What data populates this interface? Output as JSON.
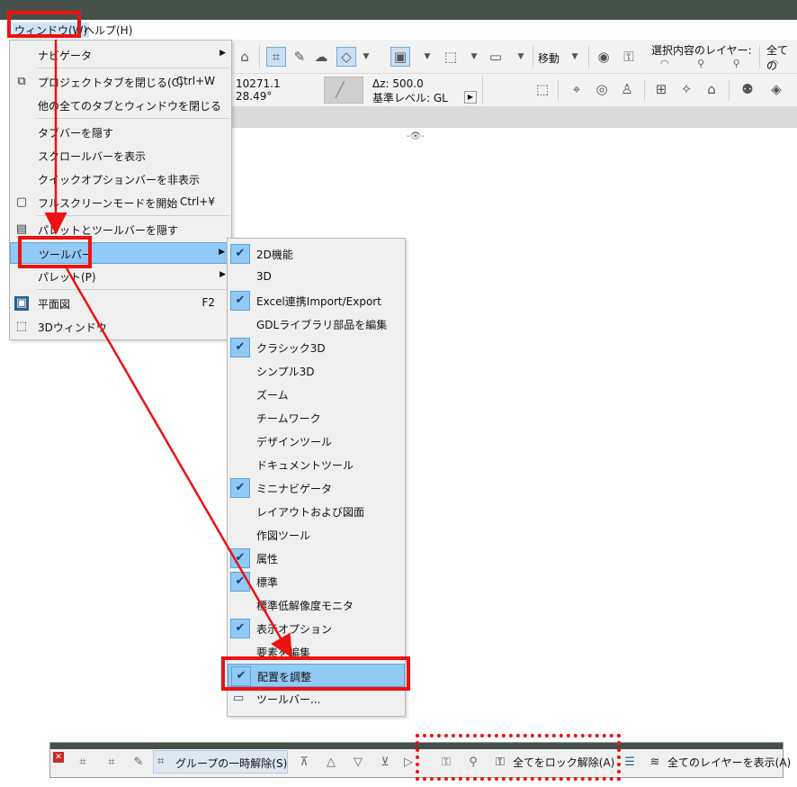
{
  "menubar": {
    "window": "ウィンドウ(W)",
    "help": "ヘルプ(H)"
  },
  "toolbar": {
    "move_label": "移動",
    "layer_label": "選択内容のレイヤー:",
    "all_label": "全ての",
    "x_value": "10271.1",
    "angle_value": "28.49°",
    "dz_label": "Δz: 500.0",
    "level_label": "基準レベル: GL",
    "eye_indicator": "-👁-"
  },
  "window_menu": {
    "items": [
      {
        "label": "ナビゲータ",
        "submenu": true
      },
      {
        "label": "プロジェクトタブを閉じる(C)",
        "shortcut": "Ctrl+W",
        "icon": "close-tab-icon"
      },
      {
        "label": "他の全てのタブとウィンドウを閉じる"
      },
      {
        "label": "タブバーを隠す"
      },
      {
        "label": "スクロールバーを表示"
      },
      {
        "label": "クイックオプションバーを非表示"
      },
      {
        "label": "フルスクリーンモードを開始",
        "shortcut": "Ctrl+¥",
        "icon": "fullscreen-icon"
      },
      {
        "label": "パレットとツールバーを隠す",
        "icon": "palette-icon"
      },
      {
        "label": "ツールバー",
        "submenu": true
      },
      {
        "label": "パレット(P)",
        "submenu": true
      },
      {
        "label": "平面図",
        "shortcut": "F2",
        "icon": "floorplan-icon"
      },
      {
        "label": "3Dウィンドウ",
        "icon": "3d-window-icon"
      }
    ]
  },
  "toolbar_submenu": {
    "items": [
      {
        "label": "2D機能",
        "checked": true
      },
      {
        "label": "3D",
        "checked": false
      },
      {
        "label": "Excel連携Import/Export",
        "checked": true
      },
      {
        "label": "GDLライブラリ部品を編集",
        "checked": false
      },
      {
        "label": "クラシック3D",
        "checked": true
      },
      {
        "label": "シンプル3D",
        "checked": false
      },
      {
        "label": "ズーム",
        "checked": false
      },
      {
        "label": "チームワーク",
        "checked": false
      },
      {
        "label": "デザインツール",
        "checked": false
      },
      {
        "label": "ドキュメントツール",
        "checked": false
      },
      {
        "label": "ミニナビゲータ",
        "checked": true
      },
      {
        "label": "レイアウトおよび図面",
        "checked": false
      },
      {
        "label": "作図ツール",
        "checked": false
      },
      {
        "label": "属性",
        "checked": true
      },
      {
        "label": "標準",
        "checked": true
      },
      {
        "label": "標準低解像度モニタ",
        "checked": false
      },
      {
        "label": "表示オプション",
        "checked": true
      },
      {
        "label": "要素を編集",
        "checked": false
      },
      {
        "label": "配置を調整",
        "checked": true
      },
      {
        "label": "ツールバー...",
        "checked": false,
        "icon": "toolbar-icon"
      }
    ]
  },
  "bottom_toolbar": {
    "ungroup_label": "グループの一時解除(S)",
    "unlock_all_label": "全てをロック解除(A)",
    "show_layers_label": "全てのレイヤーを表示(A)"
  },
  "colors": {
    "highlight": "#91c9f7",
    "annotation_red": "#ee1111",
    "title_bar": "#46504a"
  }
}
